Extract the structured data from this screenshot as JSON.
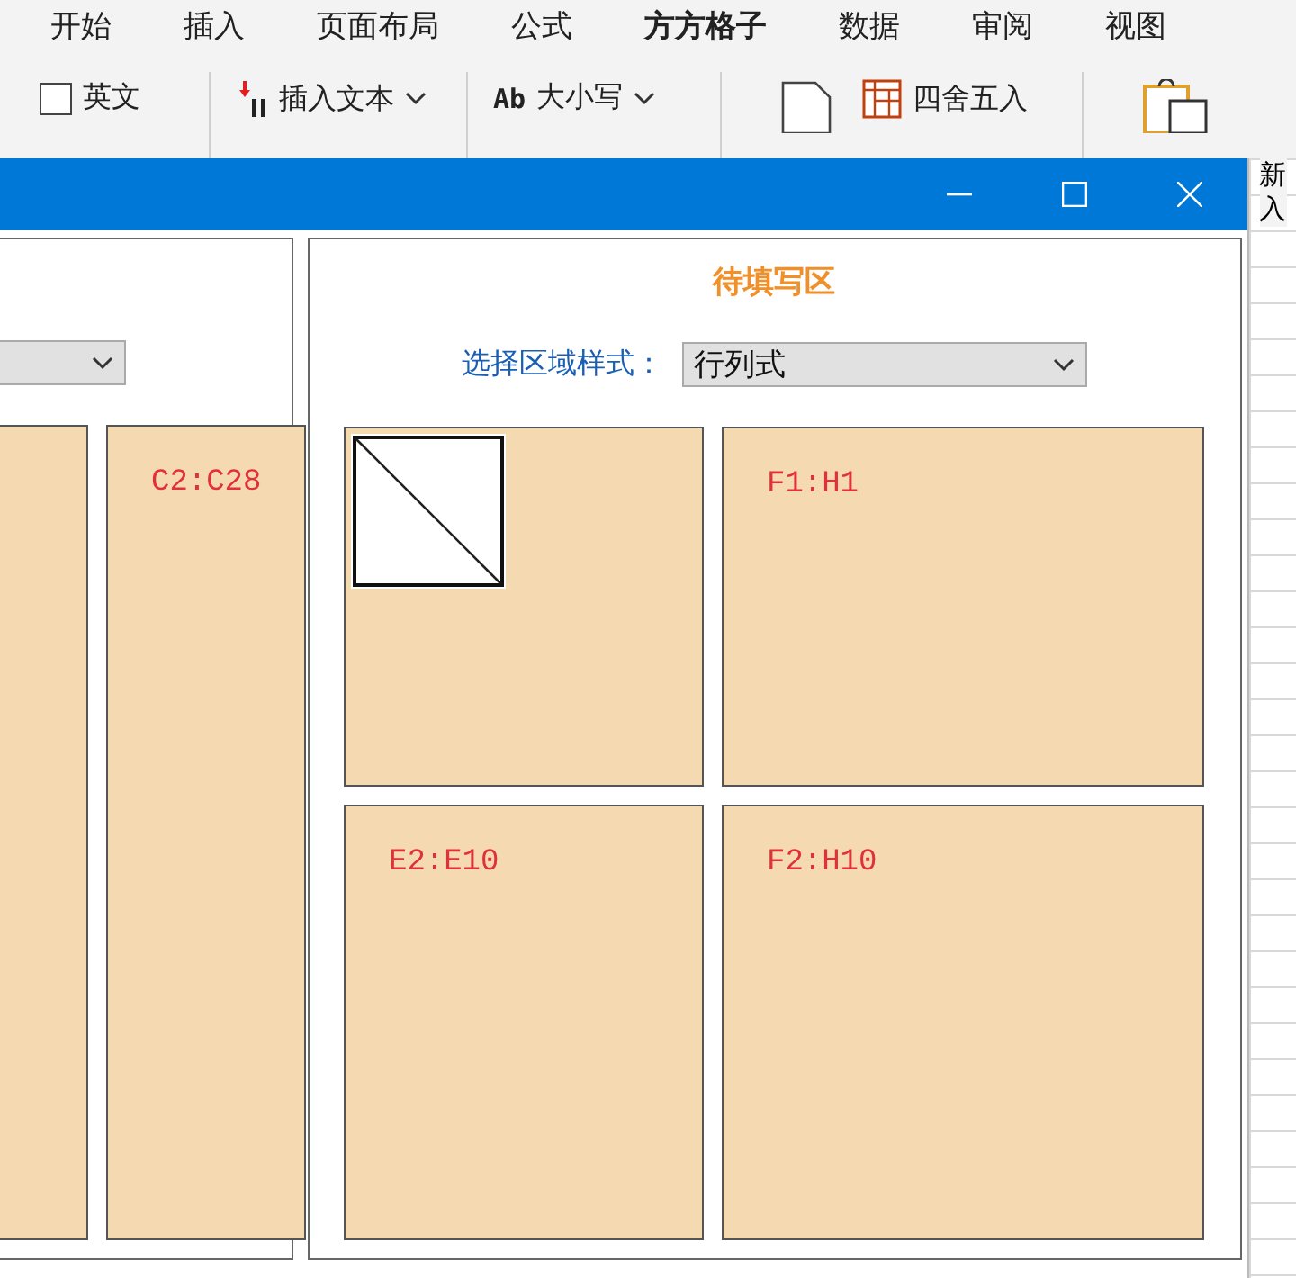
{
  "ribbon": {
    "tabs": [
      {
        "label": "开始",
        "selected": false
      },
      {
        "label": "插入",
        "selected": false
      },
      {
        "label": "页面布局",
        "selected": false
      },
      {
        "label": "公式",
        "selected": false
      },
      {
        "label": "方方格子",
        "selected": true
      },
      {
        "label": "数据",
        "selected": false
      },
      {
        "label": "审阅",
        "selected": false
      },
      {
        "label": "视图",
        "selected": false
      }
    ],
    "items": [
      {
        "kind": "checkbox",
        "label": "英文",
        "checked": false
      },
      {
        "kind": "menu",
        "label": "插入文本"
      },
      {
        "kind": "menu",
        "prefix": "Ab",
        "label": "大小写"
      },
      {
        "kind": "button",
        "label": "四舍五入"
      }
    ],
    "side_label": [
      "新",
      "入"
    ]
  },
  "dialog": {
    "left_panel": {
      "cards": [
        {
          "kind": "blank"
        },
        {
          "kind": "range",
          "label": "C2:C28"
        }
      ]
    },
    "right_panel": {
      "title": "待填写区",
      "style_label": "选择区域样式：",
      "style_value": "行列式",
      "cards": [
        {
          "kind": "corner"
        },
        {
          "kind": "range",
          "label": "F1:H1"
        },
        {
          "kind": "range",
          "label": "E2:E10"
        },
        {
          "kind": "range",
          "label": "F2:H10"
        }
      ]
    }
  }
}
